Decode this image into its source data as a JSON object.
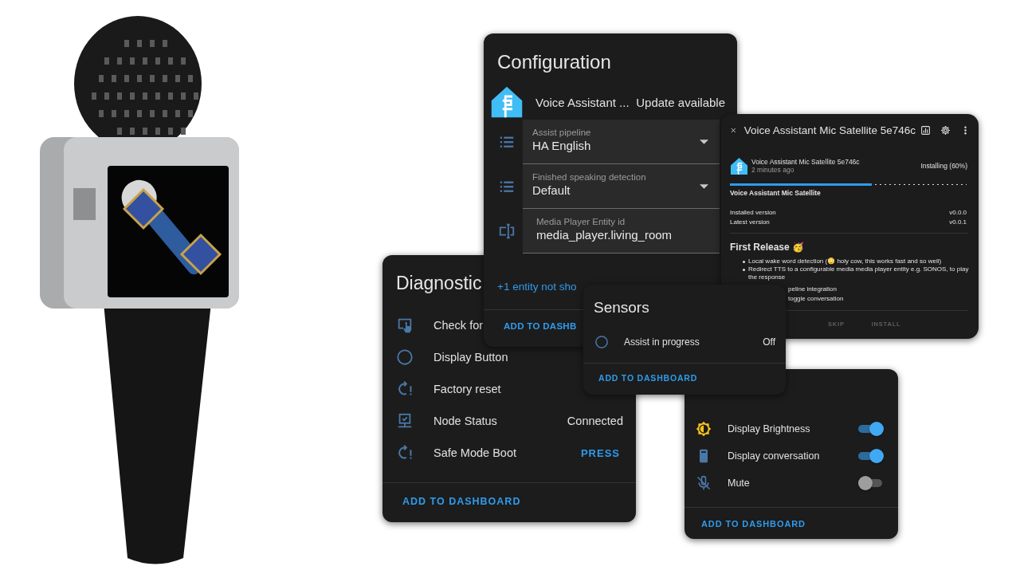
{
  "configuration_card": {
    "title": "Configuration",
    "device": {
      "name": "Voice Assistant ...",
      "status": "Update available"
    },
    "fields": [
      {
        "kind": "select",
        "label": "Assist pipeline",
        "value": "HA English"
      },
      {
        "kind": "select",
        "label": "Finished speaking detection",
        "value": "Default"
      },
      {
        "kind": "text",
        "label": "Media Player Entity id",
        "value": "media_player.living_room"
      }
    ],
    "more_link": "+1 entity not sho",
    "action": "ADD TO DASHB"
  },
  "update_dialog": {
    "title": "Voice Assistant Mic Satellite 5e746c",
    "item": {
      "name": "Voice Assistant Mic Satellite 5e746c",
      "time": "2 minutes ago",
      "status": "Installing (60%)",
      "level": 0.6
    },
    "heading": "Voice Assistant Mic Satellite",
    "versions": [
      {
        "label": "Installed version",
        "value": "v0.0.0"
      },
      {
        "label": "Latest version",
        "value": "v0.0.1"
      }
    ],
    "release_title": "First Release 🥳",
    "notes": [
      "Local wake word detection (😳 holy cow, this works fast and so well)",
      "Redirect TTS to a configurable media media player entity e.g. SONOS, to play the response"
    ],
    "notes_partly_hidden": [
      "peline integration",
      "toggle conversation"
    ],
    "buttons": [
      {
        "label": "SKIP",
        "disabled": true
      },
      {
        "label": "INSTALL",
        "disabled": true
      }
    ]
  },
  "diagnostic_card": {
    "title": "Diagnostic",
    "rows": [
      {
        "kind": "update",
        "label": "Check for"
      },
      {
        "kind": "button",
        "label": "Display Button"
      },
      {
        "kind": "restart",
        "label": "Factory reset"
      },
      {
        "kind": "status",
        "label": "Node Status",
        "value": "Connected"
      },
      {
        "kind": "restart",
        "label": "Safe Mode Boot",
        "action": "PRESS"
      }
    ],
    "action": "ADD TO DASHBOARD"
  },
  "sensors_card": {
    "title": "Sensors",
    "rows": [
      {
        "label": "Assist in progress",
        "value": "Off"
      }
    ],
    "action": "ADD TO DASHBOARD"
  },
  "controls_card": {
    "rows": [
      {
        "kind": "brightness",
        "label": "Display Brightness",
        "on": true
      },
      {
        "kind": "display",
        "label": "Display conversation",
        "on": true
      },
      {
        "kind": "mute",
        "label": "Mute",
        "on": false
      }
    ],
    "action": "ADD TO DASHBOARD"
  }
}
